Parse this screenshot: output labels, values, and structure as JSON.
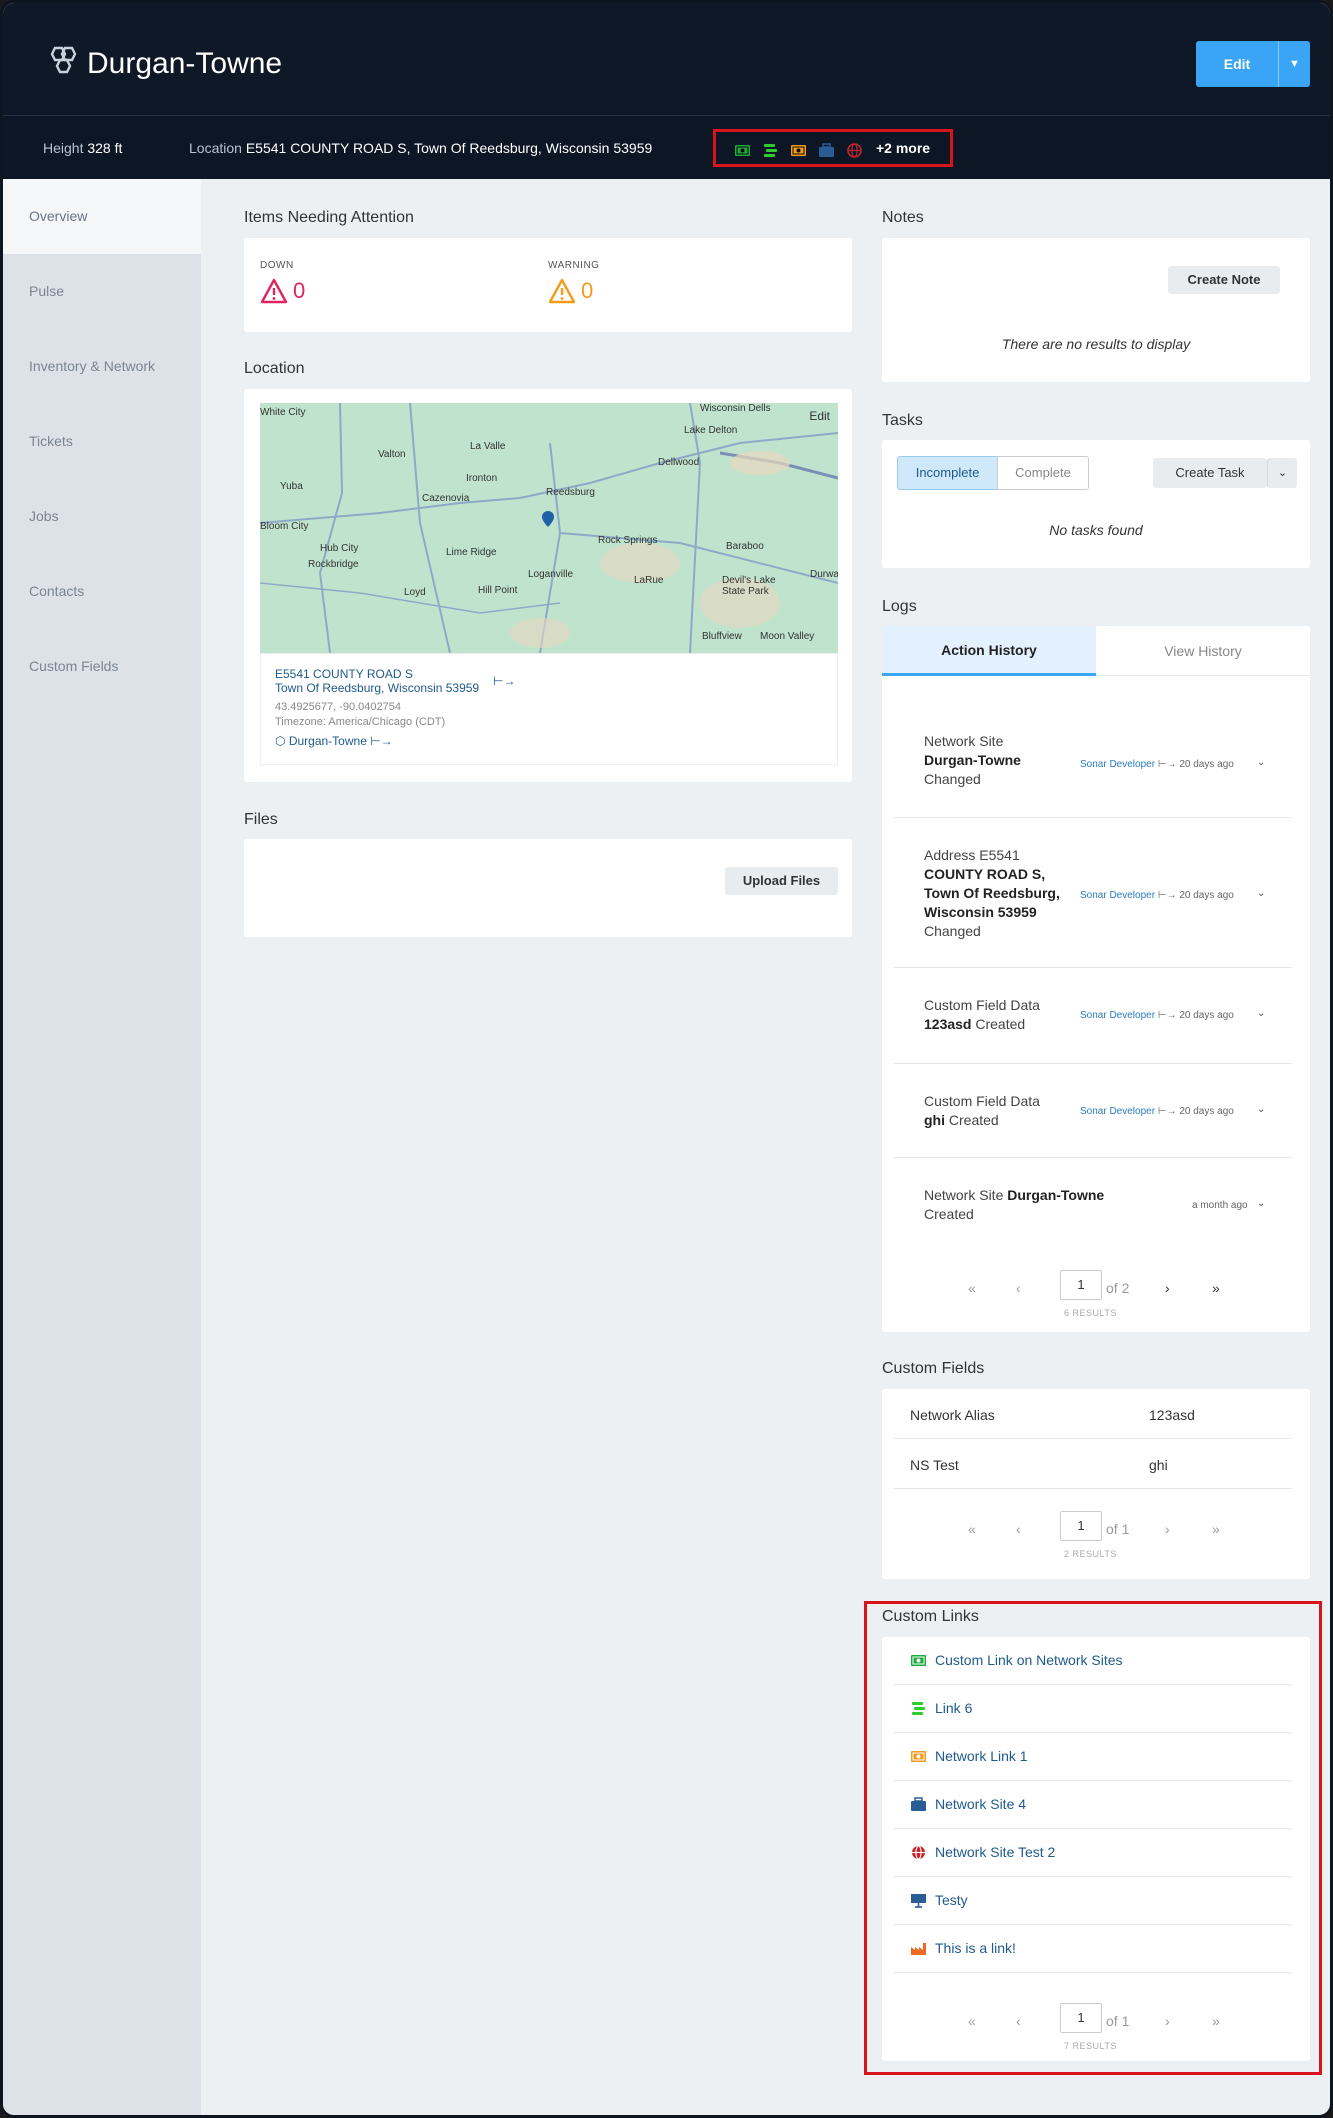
{
  "header": {
    "title": "Durgan-Towne",
    "edit_label": "Edit",
    "height_label": "Height",
    "height_value": "328 ft",
    "location_label": "Location",
    "location_value": "E5541 COUNTY ROAD S, Town Of Reedsburg, Wisconsin 53959",
    "more_links": "+2 more",
    "link_icons": [
      {
        "icon": "money-icon",
        "color": "#1faa3c"
      },
      {
        "icon": "stack-icon",
        "color": "#2fcb2f"
      },
      {
        "icon": "money-icon",
        "color": "#f29b1d"
      },
      {
        "icon": "briefcase-icon",
        "color": "#2a5d96"
      },
      {
        "icon": "globe-icon",
        "color": "#c0262c"
      }
    ]
  },
  "sidebar": {
    "items": [
      "Overview",
      "Pulse",
      "Inventory & Network",
      "Tickets",
      "Jobs",
      "Contacts",
      "Custom Fields"
    ]
  },
  "attention": {
    "title": "Items Needing Attention",
    "down_label": "DOWN",
    "down_value": "0",
    "warning_label": "WARNING",
    "warning_value": "0"
  },
  "location": {
    "title": "Location",
    "map_edit": "Edit",
    "map_places": [
      "White City",
      "Valton",
      "La Valle",
      "Yuba",
      "Ironton",
      "Cazenovia",
      "Reedsburg",
      "Dellwood",
      "Lake Delton",
      "Wisconsin Dells",
      "Hub City",
      "Rockbridge",
      "Lime Ridge",
      "Rock Springs",
      "Baraboo",
      "Loganville",
      "LaRue",
      "Devil's Lake State Park",
      "Durward",
      "Loyd",
      "Hill Point",
      "Bluffview",
      "Moon Valley",
      "Bloom City"
    ],
    "address_line1": "E5541 COUNTY ROAD S",
    "address_line2": "Town Of Reedsburg, Wisconsin 53959",
    "coords": "43.4925677, -90.0402754",
    "timezone": "Timezone: America/Chicago (CDT)",
    "site_link": "Durgan-Towne"
  },
  "files": {
    "title": "Files",
    "upload_label": "Upload Files"
  },
  "notes": {
    "title": "Notes",
    "create_label": "Create Note",
    "empty": "There are no results to display"
  },
  "tasks": {
    "title": "Tasks",
    "tab_incomplete": "Incomplete",
    "tab_complete": "Complete",
    "create_label": "Create Task",
    "empty": "No tasks found"
  },
  "logs": {
    "title": "Logs",
    "tab_action": "Action History",
    "tab_view": "View History",
    "entries": [
      {
        "l1": "Network Site",
        "l2": "Durgan-Towne",
        "l3": "Changed",
        "who": "Sonar Developer",
        "when": "20 days ago"
      },
      {
        "l1": "Address E5541",
        "l2": "COUNTY ROAD S,",
        "l3": "Town Of Reedsburg,",
        "l4": "Wisconsin 53959",
        "l5": "Changed",
        "who": "Sonar Developer",
        "when": "20 days ago"
      },
      {
        "l1": "Custom Field Data",
        "l2": "123asd",
        "l3": "Created",
        "who": "Sonar Developer",
        "when": "20 days ago"
      },
      {
        "l1": "Custom Field Data",
        "l2": "ghi",
        "l3": "Created",
        "who": "Sonar Developer",
        "when": "20 days ago"
      },
      {
        "l1": "Network Site",
        "l2": "Durgan-Towne",
        "l3": "Created",
        "who": "",
        "when": "a month ago"
      }
    ],
    "page": "1",
    "of": "of 2",
    "results": "6 RESULTS"
  },
  "custom_fields": {
    "title": "Custom Fields",
    "rows": [
      {
        "name": "Network Alias",
        "value": "123asd"
      },
      {
        "name": "NS Test",
        "value": "ghi"
      }
    ],
    "page": "1",
    "of": "of 1",
    "results": "2 RESULTS"
  },
  "custom_links": {
    "title": "Custom Links",
    "items": [
      {
        "label": "Custom Link on Network Sites",
        "icon": "money-icon",
        "color": "#1faa3c"
      },
      {
        "label": "Link 6",
        "icon": "stack-icon",
        "color": "#2fcb2f"
      },
      {
        "label": "Network Link 1",
        "icon": "money-icon",
        "color": "#f29b1d"
      },
      {
        "label": "Network Site 4",
        "icon": "briefcase-icon",
        "color": "#2a5d96"
      },
      {
        "label": "Network Site Test 2",
        "icon": "globe-icon",
        "color": "#c0262c"
      },
      {
        "label": "Testy",
        "icon": "presentation-icon",
        "color": "#2a5d96"
      },
      {
        "label": "This is a link!",
        "icon": "factory-icon",
        "color": "#ee6a24"
      }
    ],
    "page": "1",
    "of": "of 1",
    "results": "7 RESULTS"
  },
  "pager_symbols": {
    "first": "«",
    "prev": "‹",
    "next": "›",
    "last": "»"
  }
}
